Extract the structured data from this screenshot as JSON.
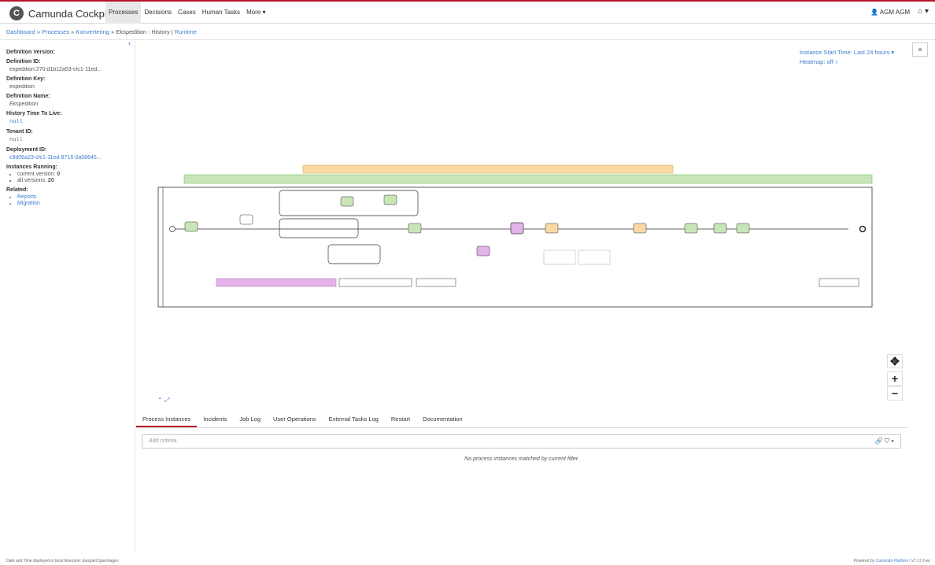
{
  "brand": {
    "name": "Camunda Cockpit"
  },
  "nav": {
    "items": [
      "Processes",
      "Decisions",
      "Cases",
      "Human Tasks",
      "More ▾"
    ],
    "user": "AGM AGM",
    "home": "⌂ ▾"
  },
  "breadcrumb": {
    "dashboard": "Dashboard",
    "processes": "Processes",
    "parent": "Konvertering",
    "sep": "»",
    "current": "Ekspedition : History",
    "pipe": "|",
    "runtime": "Runtime"
  },
  "sidebar": {
    "definition_version_label": "Definition Version:",
    "definition_id_label": "Definition ID:",
    "definition_id": "expedition:270:d1b12a53-cfc1-11ed...",
    "definition_key_label": "Definition Key:",
    "definition_key": "expedition",
    "definition_name_label": "Definition Name:",
    "definition_name": "Ekspedition",
    "history_ttl_label": "History Time To Live:",
    "history_ttl": "null",
    "tenant_label": "Tenant ID:",
    "tenant": "null",
    "deployment_label": "Deployment ID:",
    "deployment": "c9d06a23-cfc1-11ed-8716-0a58645...",
    "instances_label": "Instances Running:",
    "current_version_label": "current version:",
    "current_version": "0",
    "all_versions_label": "all versions:",
    "all_versions": "20",
    "related_label": "Related:",
    "related": [
      "Reports",
      "Migration"
    ]
  },
  "diagram_controls": {
    "start_time": "Instance Start Time: Last 24 hours ▾",
    "heatmap": "Heatmap: off ○",
    "close": "×",
    "move": "✥",
    "zoom_in": "+",
    "zoom_out": "−",
    "expand": "⌃ ⤢"
  },
  "tabs": [
    "Process Instances",
    "Incidents",
    "Job Log",
    "User Operations",
    "External Tasks Log",
    "Restart",
    "Documentation"
  ],
  "filter": {
    "placeholder": "Add criteria",
    "tools": "🔗 ⛉ ▾"
  },
  "results": {
    "empty": "No process instances matched by current filter."
  },
  "footer": {
    "timezone": "Date and Time displayed in local timezone: ",
    "tz": "Europe/Copenhagen",
    "powered": "Powered by ",
    "platform": "Camunda Platform",
    "version": " / v7.17.2-ee"
  },
  "colors": {
    "accent": "#b5152b",
    "link": "#3a7ccf",
    "green": "#c8e6b8",
    "orange": "#fbd9a6",
    "purple": "#e4b3ea"
  }
}
